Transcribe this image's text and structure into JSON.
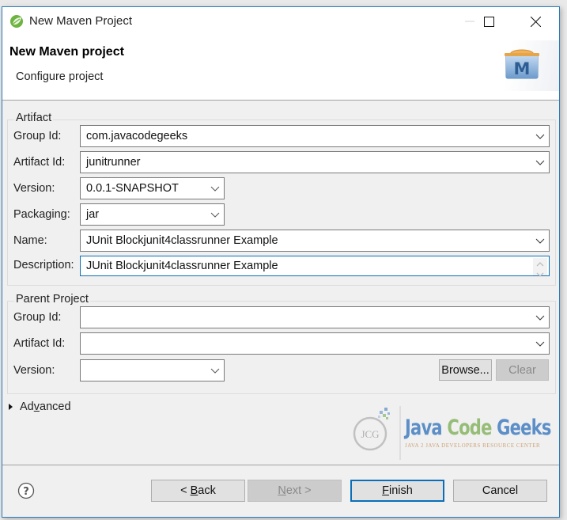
{
  "window": {
    "title": "New Maven Project",
    "controls": {
      "minimize": "minimize",
      "maximize": "maximize",
      "close": "close"
    }
  },
  "header": {
    "title": "New Maven project",
    "subtitle": "Configure project"
  },
  "artifact": {
    "legend": "Artifact",
    "group_id": {
      "label": "Group Id:",
      "value": "com.javacodegeeks"
    },
    "artifact_id": {
      "label": "Artifact Id:",
      "value": "junitrunner"
    },
    "version": {
      "label": "Version:",
      "value": "0.0.1-SNAPSHOT"
    },
    "packaging": {
      "label": "Packaging:",
      "value": "jar"
    },
    "name": {
      "label": "Name:",
      "value": "JUnit Blockjunit4classrunner Example"
    },
    "description": {
      "label": "Description:",
      "value": "JUnit Blockjunit4classrunner Example"
    }
  },
  "parent": {
    "legend": "Parent Project",
    "group_id": {
      "label": "Group Id:",
      "value": ""
    },
    "artifact_id": {
      "label": "Artifact Id:",
      "value": ""
    },
    "version": {
      "label": "Version:",
      "value": ""
    },
    "browse_label": "Browse...",
    "clear_label": "Clear"
  },
  "advanced": {
    "label_pre": "Ad",
    "label_mnemonic": "v",
    "label_post": "anced"
  },
  "watermark": {
    "word1": "Java",
    "word2": "Code",
    "word3": "Geeks",
    "tagline": "JAVA 2 JAVA DEVELOPERS RESOURCE CENTER",
    "badge": "JCG"
  },
  "footer": {
    "back": {
      "pre": "< ",
      "mnemonic": "B",
      "post": "ack"
    },
    "next": {
      "mnemonic": "N",
      "post": "ext >"
    },
    "finish": {
      "mnemonic": "F",
      "post": "inish"
    },
    "cancel": "Cancel"
  }
}
